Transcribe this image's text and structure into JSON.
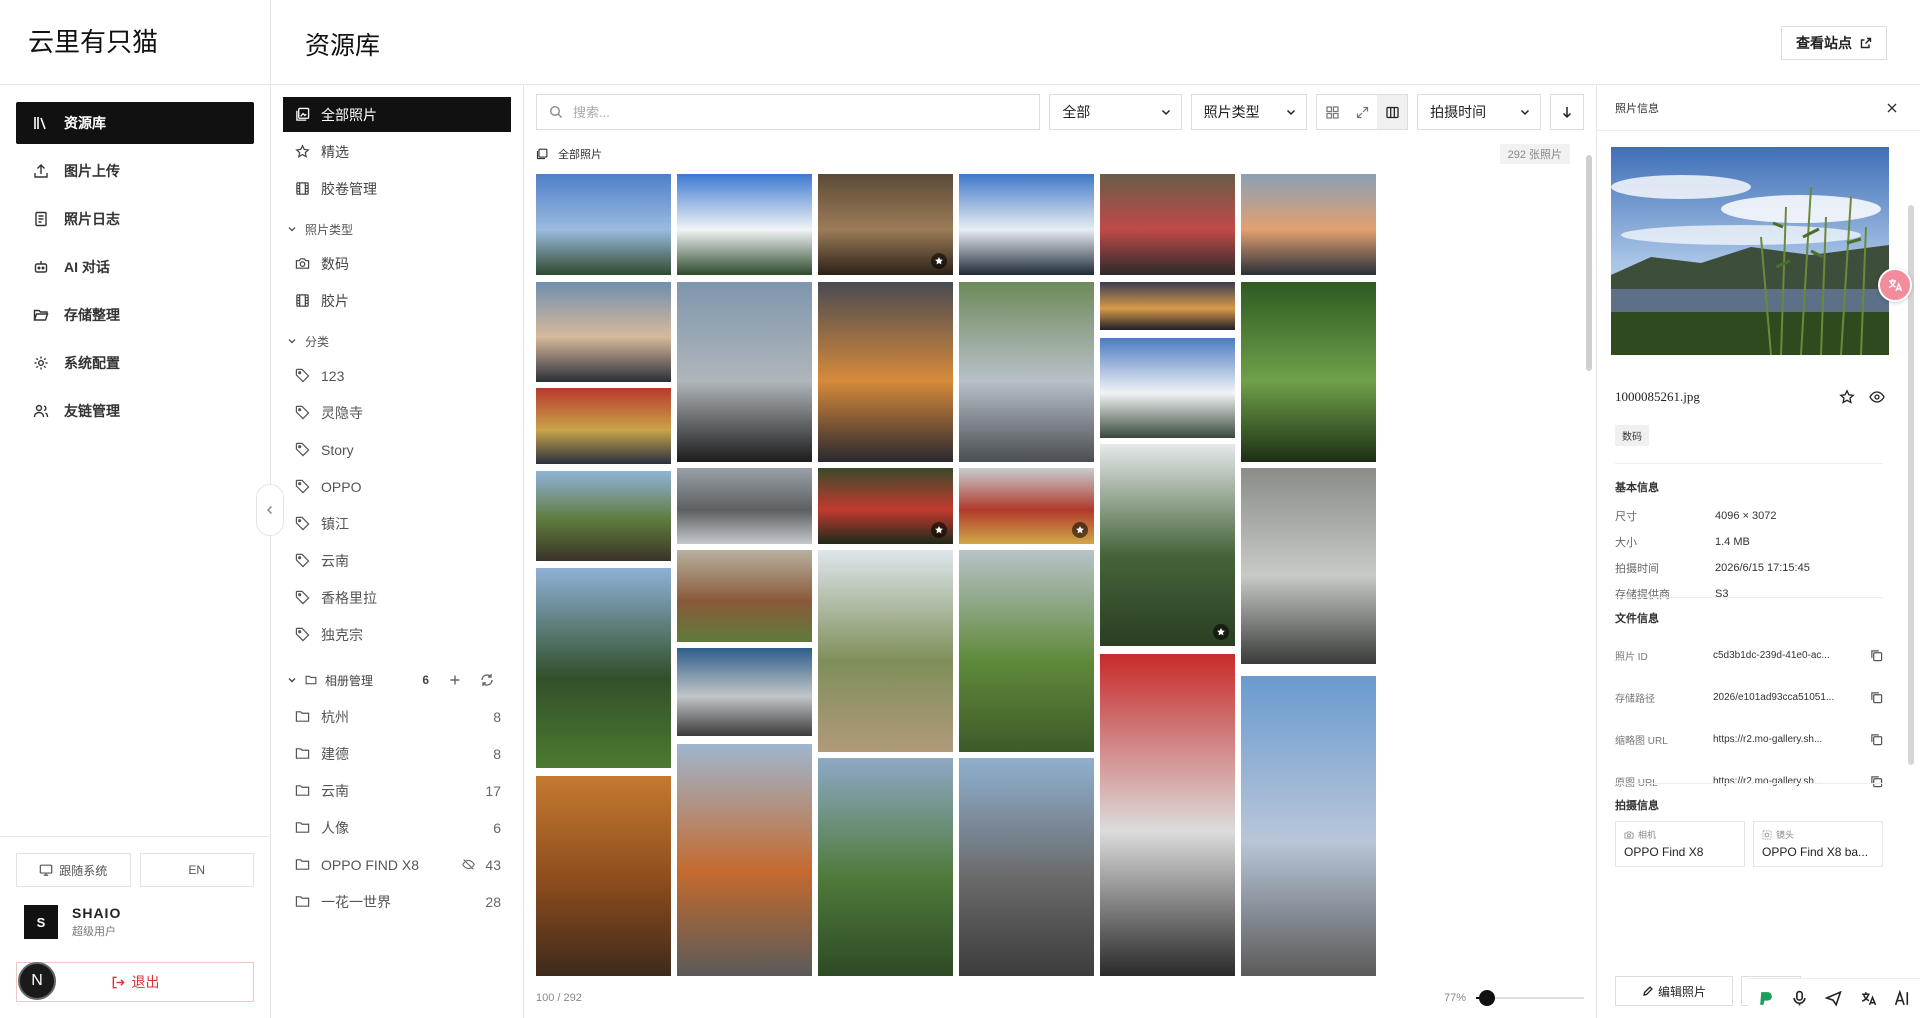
{
  "brand": "云里有只猫",
  "header": {
    "title": "资源库",
    "view_site": "查看站点"
  },
  "nav": {
    "items": [
      {
        "label": "资源库",
        "icon": "library-icon",
        "active": true
      },
      {
        "label": "图片上传",
        "icon": "upload-icon"
      },
      {
        "label": "照片日志",
        "icon": "journal-icon"
      },
      {
        "label": "AI 对话",
        "icon": "robot-icon"
      },
      {
        "label": "存储整理",
        "icon": "folder-open-icon"
      },
      {
        "label": "系统配置",
        "icon": "gear-icon"
      },
      {
        "label": "友链管理",
        "icon": "users-icon"
      }
    ],
    "theme_button": "跟随系统",
    "lang_button": "EN",
    "user": {
      "initial": "S",
      "name": "SHAIO",
      "role": "超级用户"
    },
    "logout": "退出",
    "corner_badge": "N"
  },
  "side2": {
    "main_items": [
      {
        "label": "全部照片",
        "icon": "photos-icon",
        "active": true
      },
      {
        "label": "精选",
        "icon": "star-icon"
      },
      {
        "label": "胶卷管理",
        "icon": "film-icon"
      }
    ],
    "type_section": "照片类型",
    "types": [
      {
        "label": "数码",
        "icon": "camera-icon"
      },
      {
        "label": "胶片",
        "icon": "film-icon"
      }
    ],
    "category_section": "分类",
    "tags": [
      "123",
      "灵隐寺",
      "Story",
      "OPPO",
      "镇江",
      "云南",
      "香格里拉",
      "独克宗"
    ],
    "albums_section": "相册管理",
    "albums_count": "6",
    "albums": [
      {
        "name": "杭州",
        "count": "8",
        "hidden": false
      },
      {
        "name": "建德",
        "count": "8",
        "hidden": false
      },
      {
        "name": "云南",
        "count": "17",
        "hidden": false
      },
      {
        "name": "人像",
        "count": "6",
        "hidden": false
      },
      {
        "name": "OPPO FIND X8",
        "count": "43",
        "hidden": true
      },
      {
        "name": "一花一世界",
        "count": "28",
        "hidden": false
      }
    ]
  },
  "toolbar": {
    "search_placeholder": "搜索...",
    "filter_all": "全部",
    "filter_type": "照片类型",
    "sort_by": "拍摄时间"
  },
  "gallery": {
    "crumb": "全部照片",
    "total": "292 张照片",
    "loaded": "100 / 292",
    "zoom_label": "77%",
    "zoom_fraction": 0.1
  },
  "panel": {
    "title": "照片信息",
    "filename": "1000085261.jpg",
    "badge": "数码",
    "basic_title": "基本信息",
    "basic": [
      {
        "k": "尺寸",
        "v": "4096 × 3072"
      },
      {
        "k": "大小",
        "v": "1.4 MB"
      },
      {
        "k": "拍摄时间",
        "v": "2026/6/15 17:15:45"
      },
      {
        "k": "存储提供商",
        "v": "S3"
      }
    ],
    "file_title": "文件信息",
    "file": [
      {
        "k": "照片 ID",
        "v": "c5d3b1dc-239d-41e0-ac..."
      },
      {
        "k": "存储路径",
        "v": "2026/e101ad93cca51051..."
      },
      {
        "k": "缩略图 URL",
        "v": "https://r2.mo-gallery.sh..."
      },
      {
        "k": "原图 URL",
        "v": "https://r2.mo-gallery.sh..."
      }
    ],
    "shoot_title": "拍摄信息",
    "camera_label": "相机",
    "camera": "OPPO Find X8",
    "lens_label": "镜头",
    "lens": "OPPO Find X8 ba...",
    "edit_button": "编辑照片"
  },
  "colors": {
    "accent": "#111111",
    "danger": "#e03030",
    "float_translate": "#f28b9c"
  }
}
